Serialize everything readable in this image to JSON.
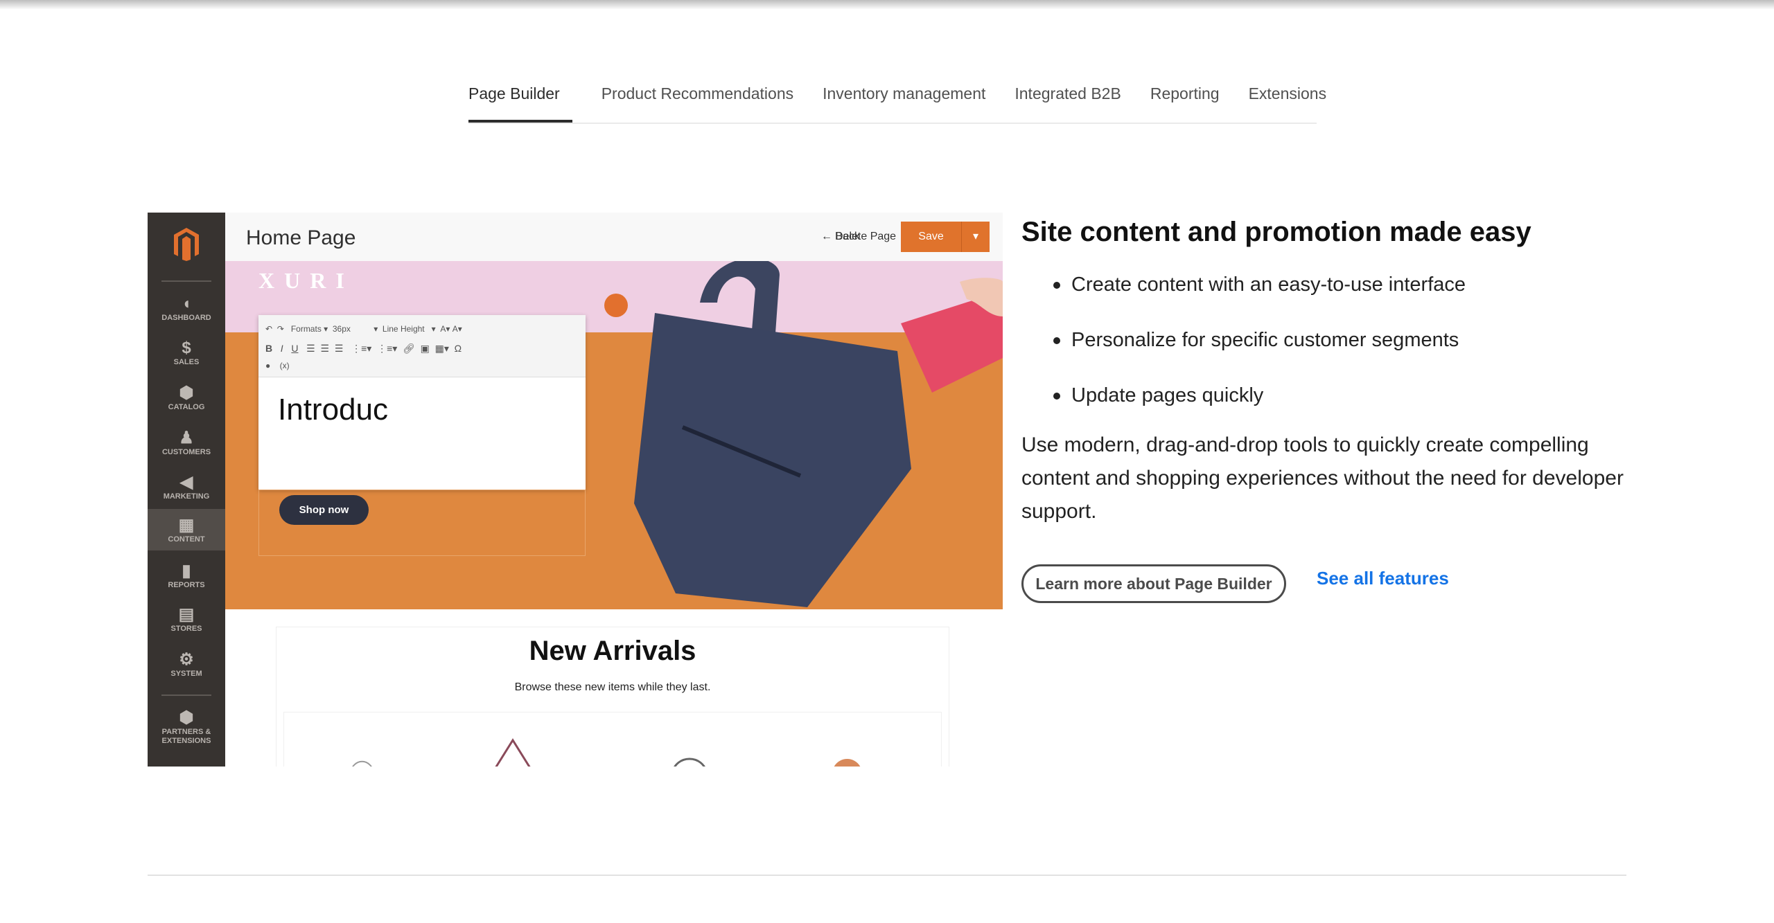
{
  "tabs": [
    {
      "label": "Page Builder",
      "active": true
    },
    {
      "label": "Product Recommendations"
    },
    {
      "label": "Inventory management"
    },
    {
      "label": "Integrated B2B"
    },
    {
      "label": "Reporting"
    },
    {
      "label": "Extensions"
    }
  ],
  "mock": {
    "sidebar": [
      {
        "label": "DASHBOARD",
        "icon": "gauge-icon"
      },
      {
        "label": "SALES",
        "icon": "dollar-icon"
      },
      {
        "label": "CATALOG",
        "icon": "box-icon"
      },
      {
        "label": "CUSTOMERS",
        "icon": "person-icon"
      },
      {
        "label": "MARKETING",
        "icon": "megaphone-icon"
      },
      {
        "label": "CONTENT",
        "icon": "layout-icon",
        "active": true
      },
      {
        "label": "REPORTS",
        "icon": "bar-chart-icon"
      },
      {
        "label": "STORES",
        "icon": "store-icon"
      },
      {
        "label": "SYSTEM",
        "icon": "gear-icon"
      },
      {
        "label": "PARTNERS & EXTENSIONS",
        "icon": "extensions-icon"
      }
    ],
    "title": "Home Page",
    "back": "Back",
    "delete": "Delete Page",
    "save": "Save",
    "brand": "XURI",
    "toolbar": {
      "formats": "Formats",
      "size": "36px",
      "line_height": "Line Height"
    },
    "editor_text": "Introduc",
    "shop_now": "Shop now",
    "arrivals_title": "New Arrivals",
    "arrivals_sub": "Browse these new items while they last."
  },
  "content": {
    "heading": "Site content and promotion made easy",
    "bullets": [
      "Create content with an easy-to-use interface",
      "Personalize for specific customer segments",
      "Update pages quickly"
    ],
    "paragraph": "Use modern, drag-and-drop tools to quickly create compelling content and shopping experiences without the need for developer support.",
    "learn_more": "Learn more about Page Builder",
    "see_all": "See all features"
  },
  "colors": {
    "accent": "#e0732c",
    "link": "#1473e6",
    "sidebar": "#373330"
  }
}
